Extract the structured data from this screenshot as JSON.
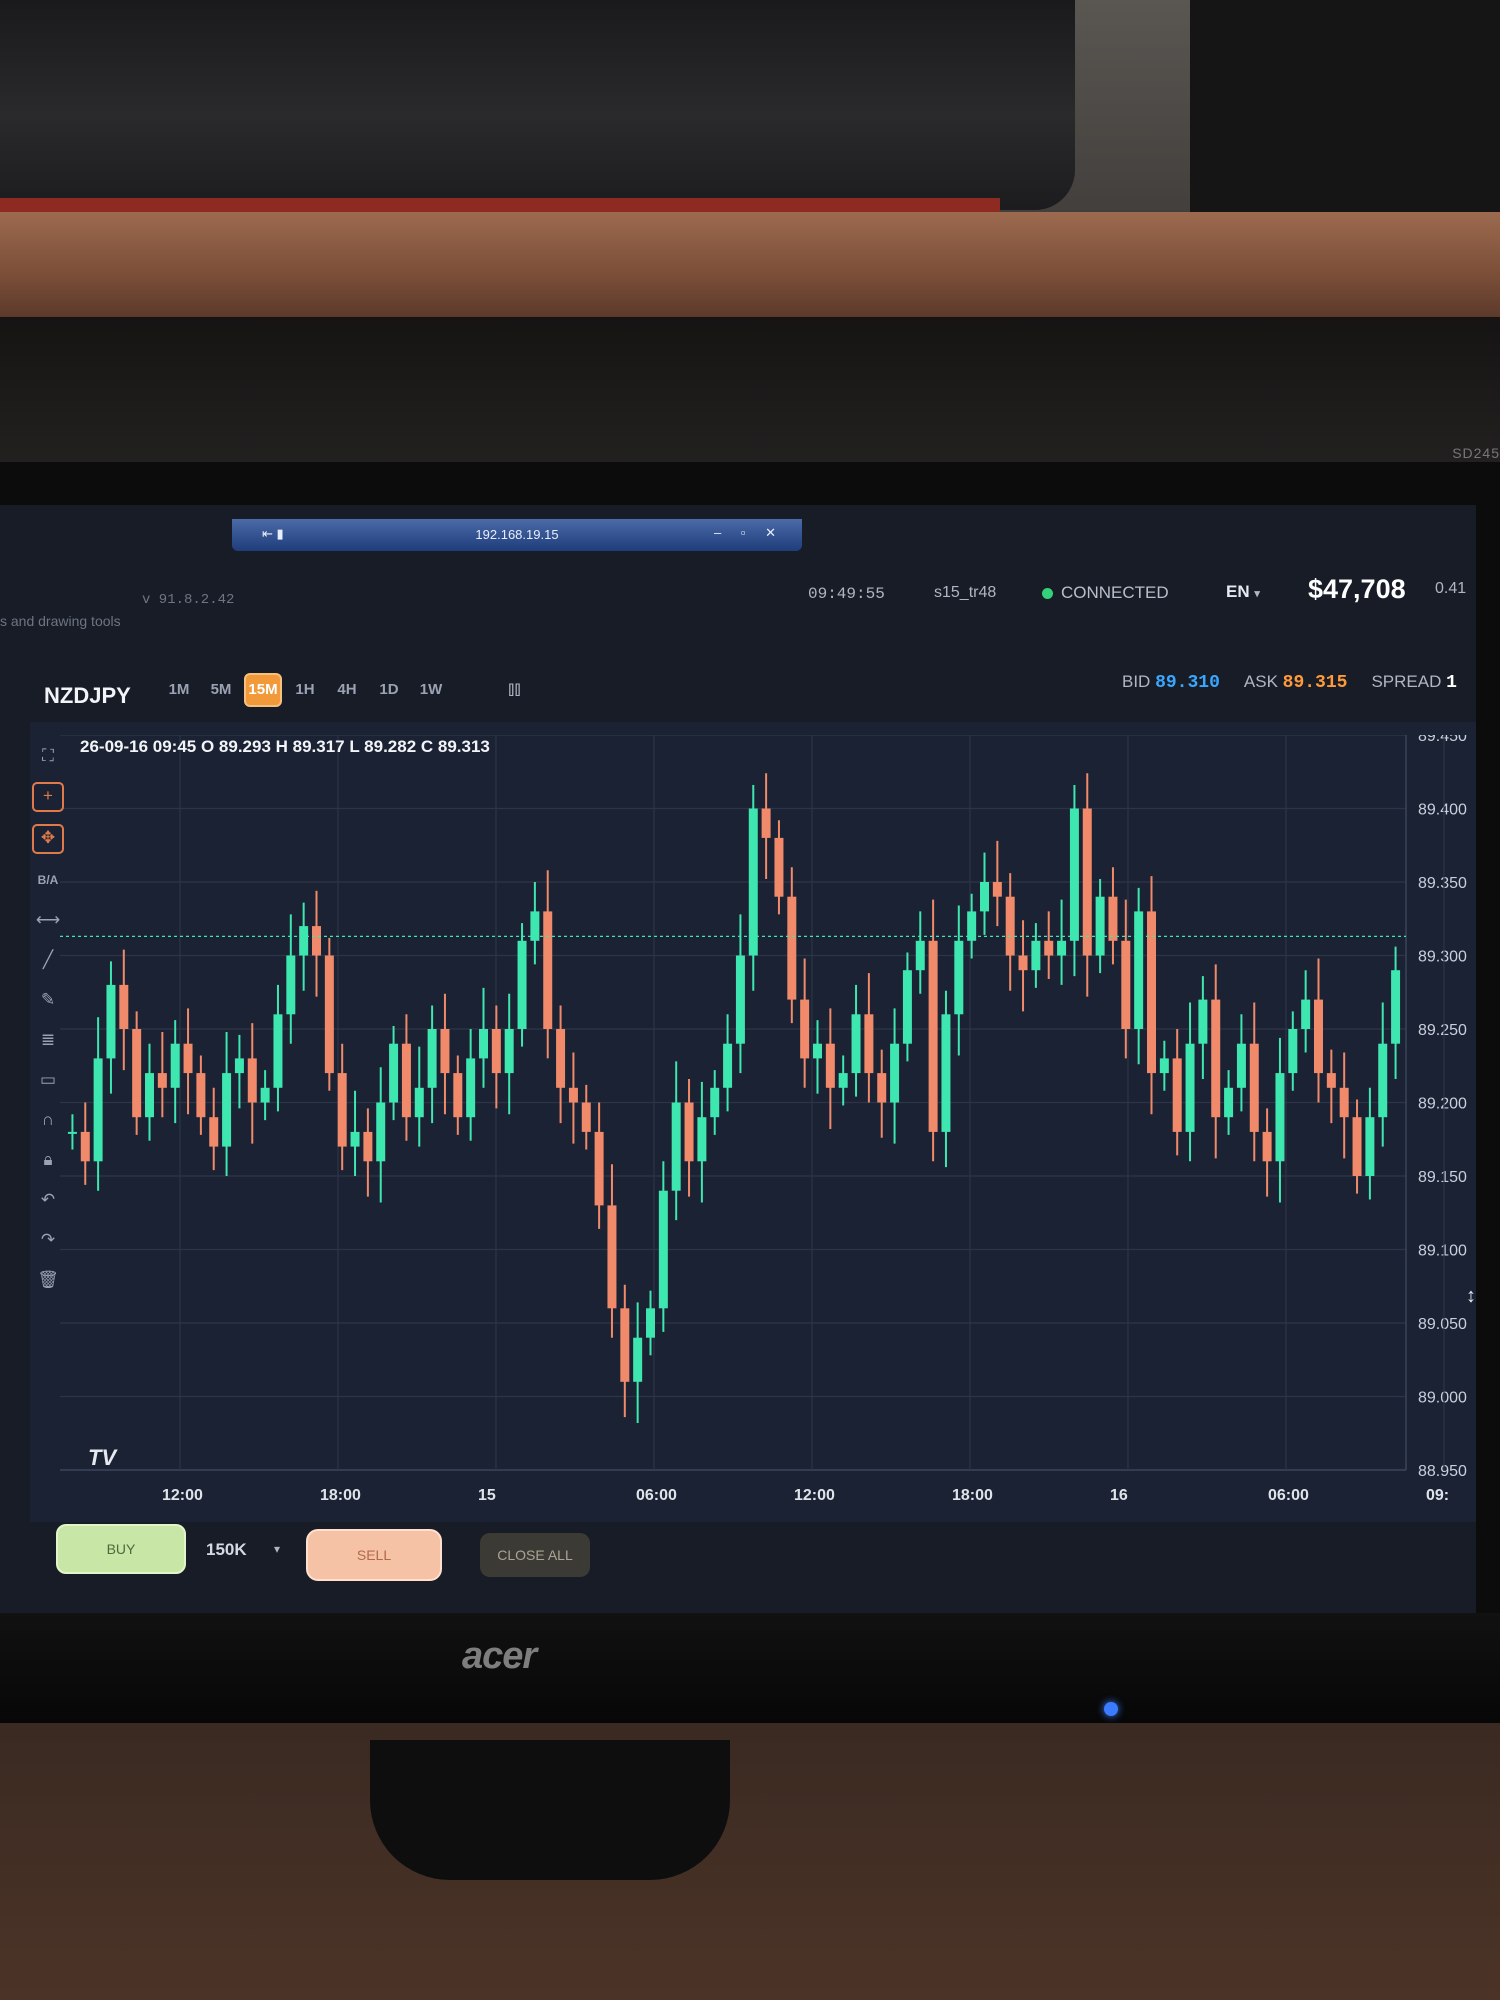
{
  "remote_desktop": {
    "address": "192.168.19.15",
    "pin_icon": "pin-icon",
    "controls": "– ▫ ✕"
  },
  "header": {
    "version": "v 91.8.2.42",
    "subtitle": "s and drawing tools",
    "clock": "09:49:55",
    "user": "s15_tr48",
    "connection": "CONNECTED",
    "language": "EN",
    "language_caret": "▾",
    "balance": "$47,708",
    "balance_sub": "0.41"
  },
  "toolbar": {
    "symbol": "NZDJPY",
    "timeframes": [
      "1M",
      "5M",
      "15M",
      "1H",
      "4H",
      "1D",
      "1W"
    ],
    "active_timeframe": "15M",
    "chart_type_icon": "candles-icon",
    "bid_label": "BID",
    "bid": "89.310",
    "ask_label": "ASK",
    "ask": "89.315",
    "spread_label": "SPREAD",
    "spread": "1"
  },
  "ohlc_legend": "26-09-16 09:45 O 89.293 H 89.317 L 89.282 C 89.313",
  "left_tools": {
    "ba_label": "B/A",
    "icons": [
      "fullscreen-icon",
      "crosshair-icon",
      "move-icon",
      "measure-icon",
      "trendline-icon",
      "brush-icon",
      "fib-icon",
      "rectangle-icon",
      "magnet-icon",
      "lock-icon",
      "undo-icon",
      "redo-icon",
      "trash-icon"
    ]
  },
  "tv_logo": "TV",
  "chart_data": {
    "type": "candlestick",
    "symbol": "NZDJPY",
    "timeframe": "15M",
    "x_tick_labels": [
      "12:00",
      "18:00",
      "15",
      "06:00",
      "12:00",
      "18:00",
      "16",
      "06:00",
      "09:"
    ],
    "y_tick_labels": [
      "89.450",
      "89.400",
      "89.350",
      "89.300",
      "89.250",
      "89.200",
      "89.150",
      "89.100",
      "89.050",
      "89.000",
      "88.950"
    ],
    "ylim": [
      88.95,
      89.45
    ],
    "current_price_line": 89.313,
    "up_color": "#3ee6b0",
    "down_color": "#f08a6a",
    "close_path": [
      89.18,
      89.16,
      89.23,
      89.28,
      89.25,
      89.19,
      89.22,
      89.21,
      89.24,
      89.22,
      89.19,
      89.17,
      89.22,
      89.23,
      89.2,
      89.21,
      89.26,
      89.3,
      89.32,
      89.3,
      89.22,
      89.17,
      89.18,
      89.16,
      89.2,
      89.24,
      89.19,
      89.21,
      89.25,
      89.22,
      89.19,
      89.23,
      89.25,
      89.22,
      89.25,
      89.31,
      89.33,
      89.25,
      89.21,
      89.2,
      89.18,
      89.13,
      89.06,
      89.01,
      89.04,
      89.06,
      89.14,
      89.2,
      89.16,
      89.19,
      89.21,
      89.24,
      89.3,
      89.4,
      89.38,
      89.34,
      89.27,
      89.23,
      89.24,
      89.21,
      89.22,
      89.26,
      89.22,
      89.2,
      89.24,
      89.29,
      89.31,
      89.18,
      89.26,
      89.31,
      89.33,
      89.35,
      89.34,
      89.3,
      89.29,
      89.31,
      89.3,
      89.31,
      89.4,
      89.3,
      89.34,
      89.31,
      89.25,
      89.33,
      89.22,
      89.23,
      89.18,
      89.24,
      89.27,
      89.19,
      89.21,
      89.24,
      89.18,
      89.16,
      89.22,
      89.25,
      89.27,
      89.22,
      89.21,
      89.19,
      89.15,
      89.19,
      89.24,
      89.29
    ]
  },
  "order_bar": {
    "buy_label": "BUY",
    "quantity": "150K",
    "quantity_caret": "▾",
    "sell_label": "SELL",
    "close_all_label": "CLOSE ALL"
  },
  "monitor": {
    "brand": "acer",
    "model_label": "SD245"
  },
  "colors": {
    "accent": "#f29a3a",
    "bid": "#39a7ff",
    "ask": "#ff9a3a",
    "connected": "#33d17a",
    "background": "#181c27"
  }
}
